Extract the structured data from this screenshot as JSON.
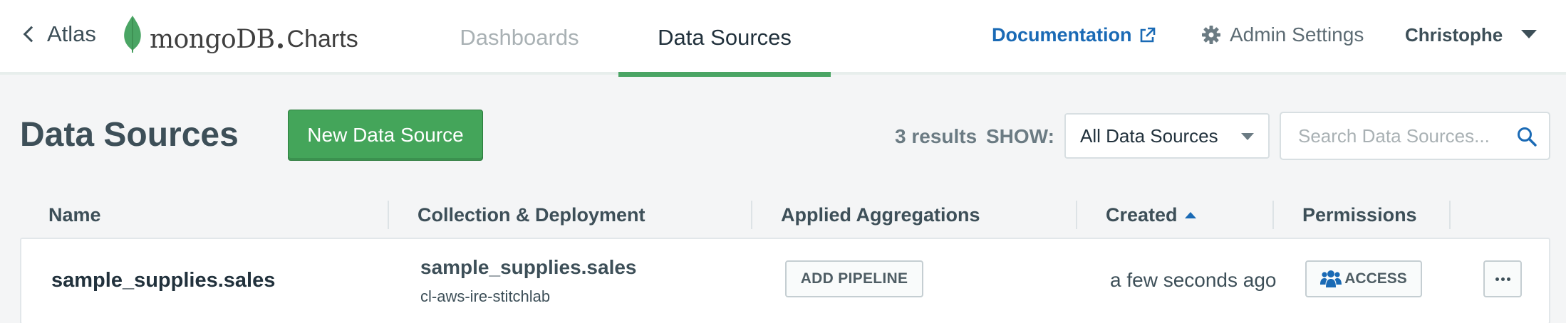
{
  "nav": {
    "back_label": "Atlas",
    "logo": {
      "brand": "mongoDB",
      "product": "Charts"
    },
    "tabs": [
      {
        "label": "Dashboards",
        "active": false
      },
      {
        "label": "Data Sources",
        "active": true
      }
    ],
    "documentation_label": "Documentation",
    "admin_label": "Admin Settings",
    "user_name": "Christophe"
  },
  "header": {
    "title": "Data Sources",
    "new_button_label": "New Data Source",
    "results_count": "3 results",
    "show_label": "SHOW:",
    "filter_selected": "All Data Sources",
    "search_placeholder": "Search Data Sources..."
  },
  "table": {
    "columns": [
      "Name",
      "Collection & Deployment",
      "Applied Aggregations",
      "Created",
      "Permissions"
    ],
    "sorted_column": "Created",
    "sort_direction": "ascending",
    "rows": [
      {
        "name": "sample_supplies.sales",
        "collection": "sample_supplies.sales",
        "deployment": "cl-aws-ire-stitchlab",
        "pipeline_button": "ADD PIPELINE",
        "created": "a few seconds ago",
        "access_button": "ACCESS"
      }
    ]
  },
  "colors": {
    "accent_green": "#44a55a",
    "tab_underline": "#4aa564",
    "link_blue": "#1a6ab5",
    "background": "#f4f5f6"
  },
  "icons": [
    "chevron-left-icon",
    "mongodb-leaf-icon",
    "external-link-icon",
    "gear-icon",
    "caret-down-icon",
    "search-icon",
    "sort-ascending-icon",
    "users-icon",
    "more-options-icon"
  ]
}
